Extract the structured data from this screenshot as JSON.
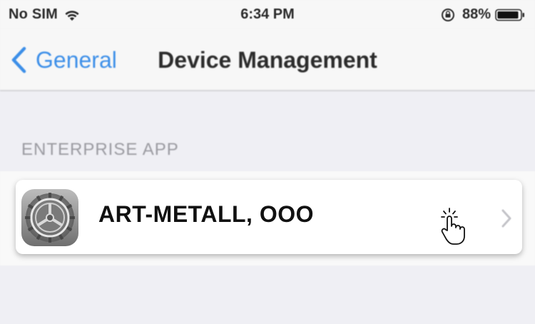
{
  "status_bar": {
    "carrier": "No SIM",
    "time": "6:34 PM",
    "battery_percent": "88%",
    "icons": [
      "wifi-icon",
      "orientation-lock-icon",
      "battery-icon"
    ]
  },
  "nav": {
    "back_label": "General",
    "title": "Device Management"
  },
  "section": {
    "header": "ENTERPRISE APP"
  },
  "profile_row": {
    "label": "ART-METALL, OOO",
    "icon": "settings-gear-icon"
  },
  "colors": {
    "accent": "#3b8ee8",
    "background": "#efeff4",
    "nav_background": "#f7f7f7",
    "header_text": "#9a9aa0"
  }
}
